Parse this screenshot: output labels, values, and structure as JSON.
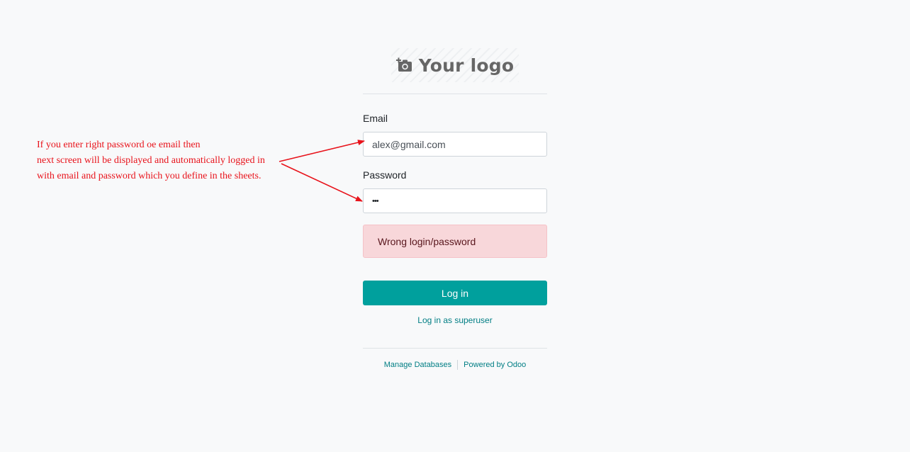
{
  "logo": {
    "text": "Your logo",
    "icon": "camera-plus-icon"
  },
  "form": {
    "email_label": "Email",
    "email_value": "alex@gmail.com",
    "password_label": "Password",
    "password_value": "•••",
    "error_message": "Wrong login/password",
    "login_button": "Log in",
    "superuser_link": "Log in as superuser"
  },
  "footer": {
    "manage_databases": "Manage Databases",
    "powered_by": "Powered by Odoo"
  },
  "annotation": {
    "lines": [
      "If you enter right password oe email then",
      "next screen will be displayed and automatically logged in",
      "with email and password which you define in the sheets."
    ],
    "color": "#e8131b"
  },
  "colors": {
    "primary": "#00a09d",
    "link": "#017e84",
    "alert_bg": "#f8d7da",
    "background": "#f8f9fa"
  }
}
